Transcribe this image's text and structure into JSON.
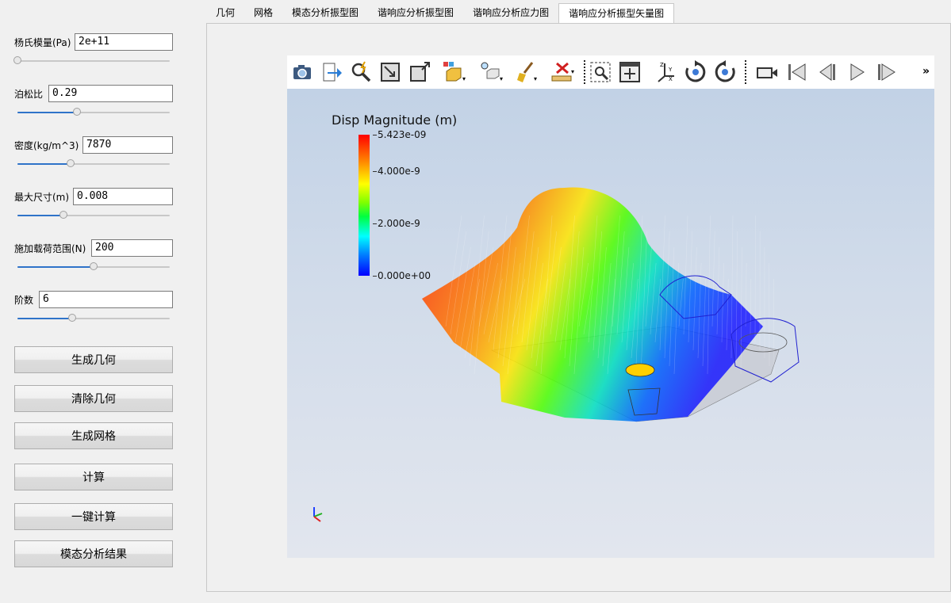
{
  "fields": [
    {
      "label": "杨氏模量(Pa)",
      "value": "2e+11",
      "slider": 0.0
    },
    {
      "label": "泊松比",
      "value": "0.29",
      "slider": 0.39
    },
    {
      "label": "密度(kg/m^3)",
      "value": "7870",
      "slider": 0.35
    },
    {
      "label": "最大尺寸(m)",
      "value": "0.008",
      "slider": 0.3
    },
    {
      "label": "施加载荷范围(N)",
      "value": "200",
      "slider": 0.5
    },
    {
      "label": "阶数",
      "value": "6",
      "slider": 0.36
    }
  ],
  "buttons": {
    "generate_geometry": "生成几何",
    "clear_geometry": "清除几何",
    "generate_mesh": "生成网格",
    "compute": "计算",
    "one_click_compute": "一键计算",
    "modal_results": "模态分析结果"
  },
  "tabs": [
    "几何",
    "网格",
    "模态分析振型图",
    "谐响应分析振型图",
    "谐响应分析应力图",
    "谐响应分析振型矢量图"
  ],
  "active_tab": 5,
  "toolbar_icons": [
    "camera-icon",
    "export-icon",
    "query-icon",
    "reset-zoom-icon",
    "select-box-icon",
    "representation-icon",
    "light-icon",
    "clear-icon",
    "ruler-icon",
    "zoom-to-box-icon",
    "fit-view-icon",
    "axes-orientation-icon",
    "rotate-cw-icon",
    "rotate-ccw-icon",
    "camera-record-icon",
    "first-frame-icon",
    "previous-frame-icon",
    "play-icon",
    "next-frame-icon"
  ],
  "toolbar_more": "»",
  "legend": {
    "title": "Disp Magnitude (m)",
    "max_label": "5.423e-09",
    "ticks": [
      "4.000e-9",
      "2.000e-9",
      "0.000e+00"
    ],
    "colors": {
      "high": "#ff0000",
      "mid": "#00ff40",
      "low": "#0000ff"
    }
  }
}
